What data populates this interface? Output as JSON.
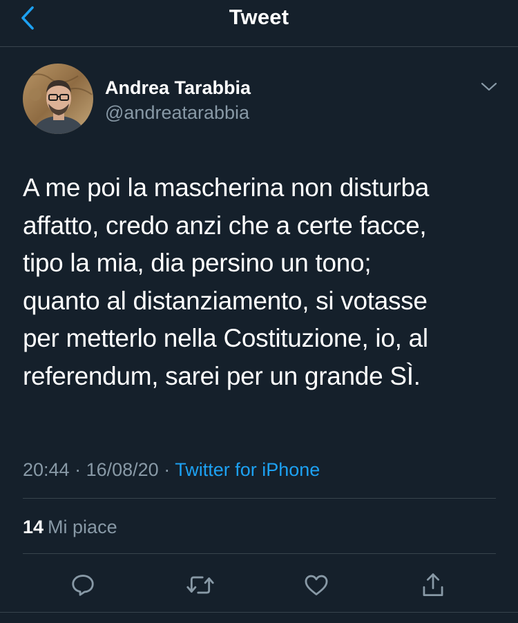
{
  "header": {
    "title": "Tweet",
    "back_icon": "chevron-left-icon",
    "accent": "#1da1f2"
  },
  "author": {
    "name": "Andrea Tarabbia",
    "handle": "@andreatarabbia",
    "menu_icon": "chevron-down-icon"
  },
  "tweet": {
    "text": "A me poi la mascherina non disturba\naffatto, credo anzi che a certe facce,\ntipo la mia, dia persino un tono;\nquanto al distanziamento, si votasse\nper metterlo nella Costituzione, io, al\nreferendum, sarei per un grande SÌ.",
    "time": "20:44",
    "separator1": " · ",
    "date": "16/08/20",
    "separator2": " · ",
    "source": "Twitter for iPhone"
  },
  "stats": {
    "likes_count": "14",
    "likes_label": "Mi piace"
  },
  "actions": {
    "reply_icon": "reply-icon",
    "retweet_icon": "retweet-icon",
    "like_icon": "heart-icon",
    "share_icon": "share-icon"
  },
  "colors": {
    "background": "#15202b",
    "border": "#38444d",
    "secondary_text": "#8899a6",
    "link": "#1da1f2"
  }
}
